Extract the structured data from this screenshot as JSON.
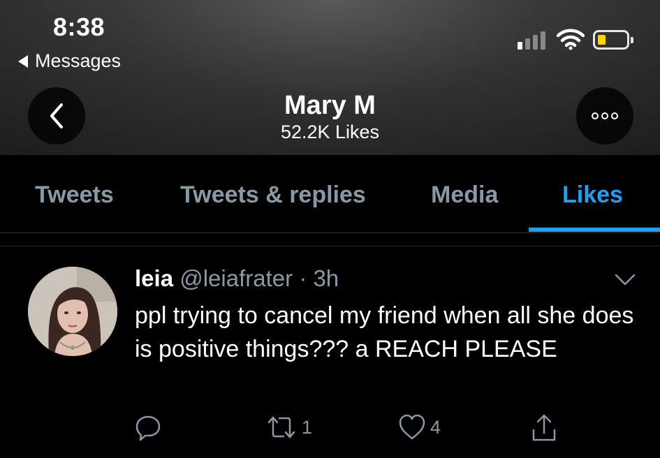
{
  "status_bar": {
    "time": "8:38",
    "back_app_label": "Messages",
    "battery_color": "#ffd60a"
  },
  "profile": {
    "name": "Mary M",
    "likes_count": "52.2K Likes"
  },
  "tabs": [
    {
      "label": "Tweets",
      "active": false
    },
    {
      "label": "Tweets & replies",
      "active": false
    },
    {
      "label": "Media",
      "active": false
    },
    {
      "label": "Likes",
      "active": true
    }
  ],
  "tweet": {
    "display_name": "leia",
    "handle": "@leiafrater",
    "separator": "·",
    "time_ago": "3h",
    "text": "ppl trying to cancel my friend when all she does is positive things??? a REACH PLEASE",
    "actions": {
      "reply_count": "",
      "retweet_count": "1",
      "like_count": "4"
    }
  },
  "icons": [
    "back-arrow-icon",
    "more-options-icon",
    "cellular-signal-icon",
    "wifi-icon",
    "battery-icon",
    "chevron-down-icon",
    "reply-icon",
    "retweet-icon",
    "like-icon",
    "share-icon"
  ],
  "colors": {
    "accent": "#1da1f2",
    "muted_text": "#8899a6",
    "background": "#000000"
  }
}
